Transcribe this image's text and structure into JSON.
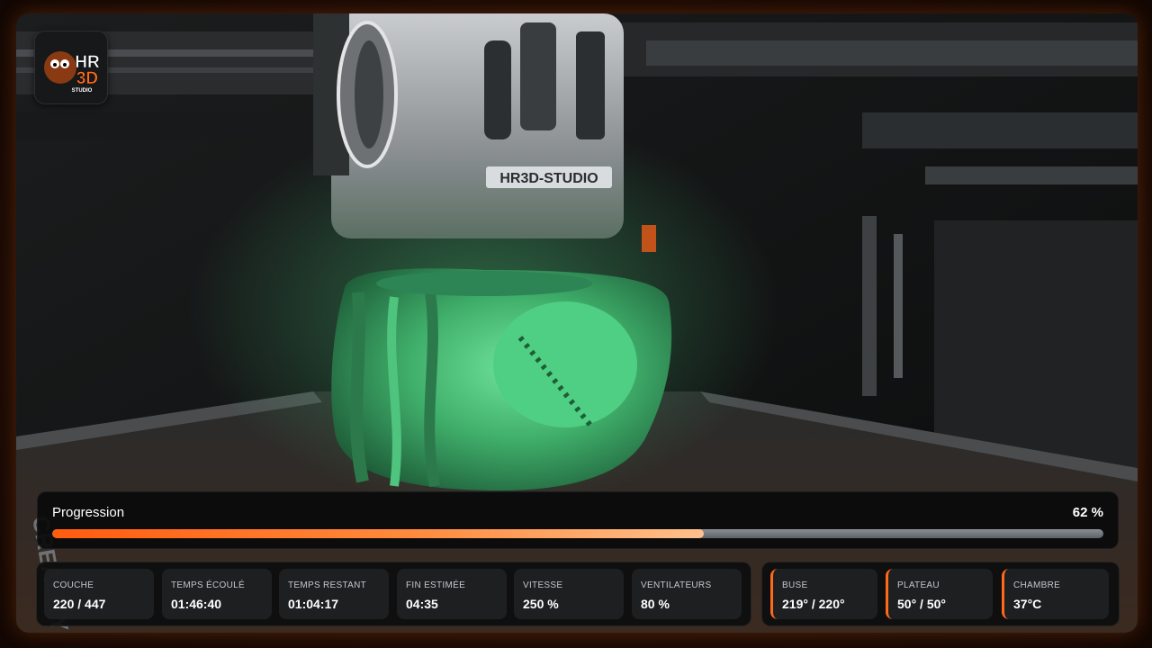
{
  "logo": {
    "line1": "HR",
    "line2": "3D",
    "line3": "STUDIO"
  },
  "camera": {
    "toolhead_label": "HR3D-STUDIO",
    "bed_label": "CREALITY"
  },
  "progress": {
    "label": "Progression",
    "percent_text": "62 %",
    "fraction": 0.62
  },
  "stats": [
    {
      "label": "COUCHE",
      "value": "220 / 447"
    },
    {
      "label": "TEMPS ÉCOULÉ",
      "value": "01:46:40"
    },
    {
      "label": "TEMPS RESTANT",
      "value": "01:04:17"
    },
    {
      "label": "FIN ESTIMÉE",
      "value": "04:35"
    },
    {
      "label": "VITESSE",
      "value": "250 %"
    },
    {
      "label": "VENTILATEURS",
      "value": "80 %"
    }
  ],
  "temps": [
    {
      "label": "BUSE",
      "value": "219° / 220°"
    },
    {
      "label": "PLATEAU",
      "value": "50° / 50°"
    },
    {
      "label": "CHAMBRE",
      "value": "37°C"
    }
  ],
  "colors": {
    "accent": "#ff6a1a",
    "print_green": "#3fae6a"
  }
}
